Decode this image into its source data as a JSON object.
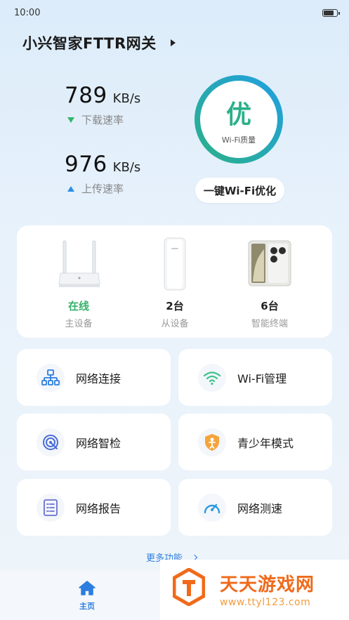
{
  "status": {
    "time": "10:00",
    "battery_level": 0.85
  },
  "header": {
    "title": "小兴智家FTTR网关"
  },
  "download": {
    "value": "789",
    "unit": "KB/s",
    "label": "下载速率"
  },
  "upload": {
    "value": "976",
    "unit": "KB/s",
    "label": "上传速率"
  },
  "quality": {
    "grade": "优",
    "label": "Wi-Fi质量",
    "ring_colors": [
      "#2bb08a",
      "#21a0e0"
    ]
  },
  "optimize": {
    "label": "一键Wi-Fi优化"
  },
  "devices": [
    {
      "icon": "router-icon",
      "count": "在线",
      "label": "主设备"
    },
    {
      "icon": "extender-icon",
      "count": "2台",
      "label": "从设备"
    },
    {
      "icon": "phone-icon",
      "count": "6台",
      "label": "智能终端"
    }
  ],
  "features": [
    {
      "icon": "network-topology-icon",
      "label": "网络连接"
    },
    {
      "icon": "wifi-icon",
      "label": "Wi-Fi管理"
    },
    {
      "icon": "network-check-icon",
      "label": "网络智检"
    },
    {
      "icon": "child-shield-icon",
      "label": "青少年模式"
    },
    {
      "icon": "report-icon",
      "label": "网络报告"
    },
    {
      "icon": "speedometer-icon",
      "label": "网络测速"
    }
  ],
  "more": {
    "label": "更多功能"
  },
  "nav": {
    "home_label": "主页",
    "accent": "#2b7de0"
  },
  "watermark": {
    "title": "天天游戏网",
    "url": "www.ttyl123.com",
    "color": "#f06a1a"
  }
}
